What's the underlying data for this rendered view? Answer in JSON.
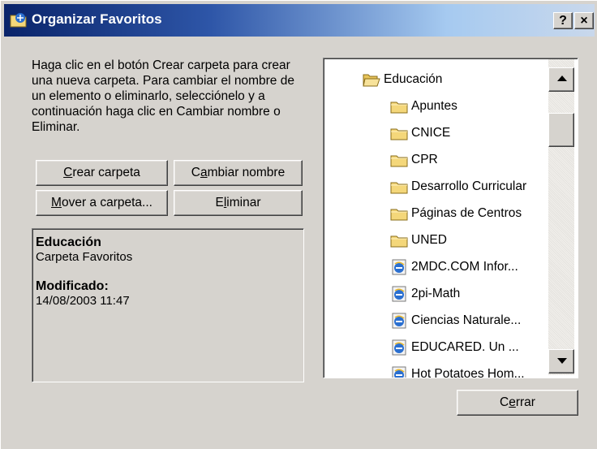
{
  "window": {
    "title": "Organizar Favoritos",
    "help_label": "?",
    "close_label": "×"
  },
  "instructions": "Haga clic en el botón Crear carpeta para crear una nueva carpeta. Para cambiar el nombre de un elemento o eliminarlo, selecciónelo y a continuación haga clic en Cambiar nombre o Eliminar.",
  "buttons": {
    "create": {
      "pre": "",
      "key": "C",
      "post": "rear carpeta"
    },
    "rename": {
      "pre": "C",
      "key": "a",
      "post": "mbiar nombre"
    },
    "move": {
      "pre": "",
      "key": "M",
      "post": "over a carpeta..."
    },
    "delete": {
      "pre": "E",
      "key": "l",
      "post": "iminar"
    },
    "close": {
      "pre": "C",
      "key": "e",
      "post": "rrar"
    }
  },
  "info": {
    "name": "Educación",
    "type": "Carpeta Favoritos",
    "modified_label": "Modificado:",
    "modified_date": "14/08/2003 11:47"
  },
  "tree": {
    "items": [
      {
        "label": "Educación",
        "icon": "open-folder-icon",
        "level": 0
      },
      {
        "label": "Apuntes",
        "icon": "folder-icon",
        "level": 1
      },
      {
        "label": "CNICE",
        "icon": "folder-icon",
        "level": 1
      },
      {
        "label": "CPR",
        "icon": "folder-icon",
        "level": 1
      },
      {
        "label": "Desarrollo Curricular",
        "icon": "folder-icon",
        "level": 1
      },
      {
        "label": "Páginas de Centros",
        "icon": "folder-icon",
        "level": 1
      },
      {
        "label": "UNED",
        "icon": "folder-icon",
        "level": 1
      },
      {
        "label": "2MDC.COM Infor...",
        "icon": "ie-link-icon",
        "level": 1
      },
      {
        "label": "2pi-Math",
        "icon": "ie-link-icon",
        "level": 1
      },
      {
        "label": "Ciencias Naturale...",
        "icon": "ie-link-icon",
        "level": 1
      },
      {
        "label": "EDUCARED. Un ...",
        "icon": "ie-link-icon",
        "level": 1
      },
      {
        "label": "Hot Potatoes Hom...",
        "icon": "ie-link-icon",
        "level": 1
      }
    ]
  },
  "colors": {
    "dialog_bg": "#d6d3ce",
    "titlebar_start": "#0a246a",
    "titlebar_end": "#c9d8ec",
    "folder": "#f4d77a",
    "ie_blue": "#2a6fd0"
  }
}
